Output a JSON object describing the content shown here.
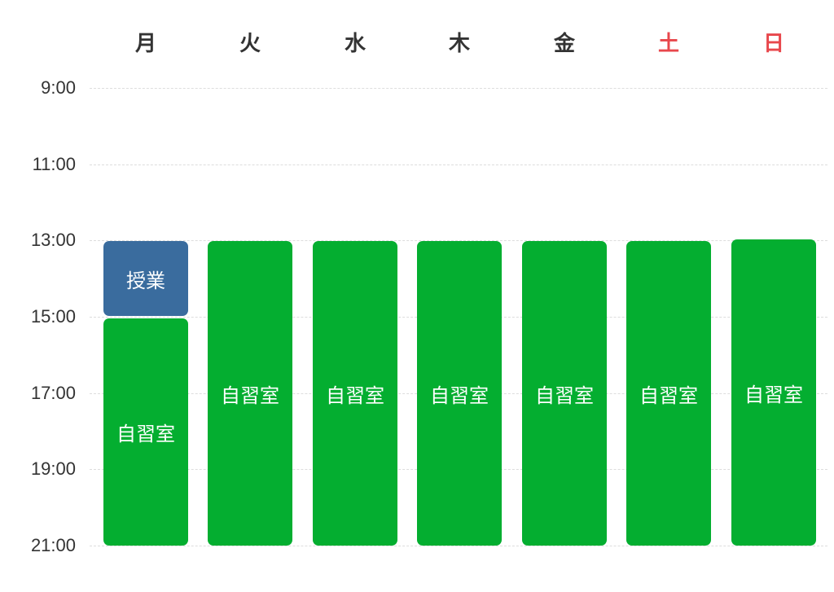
{
  "days": [
    {
      "label": "月",
      "weekend": false
    },
    {
      "label": "火",
      "weekend": false
    },
    {
      "label": "水",
      "weekend": false
    },
    {
      "label": "木",
      "weekend": false
    },
    {
      "label": "金",
      "weekend": false
    },
    {
      "label": "土",
      "weekend": true
    },
    {
      "label": "日",
      "weekend": true
    }
  ],
  "times": [
    "9:00",
    "11:00",
    "13:00",
    "15:00",
    "17:00",
    "19:00",
    "21:00"
  ],
  "colors": {
    "study": "#04ae30",
    "class": "#3a6c9e",
    "weekend_text": "#e8474c",
    "text": "#333333"
  },
  "events": [
    {
      "day": "月",
      "label": "授業",
      "kind": "class",
      "start": "13:00",
      "end": "15:00"
    },
    {
      "day": "月",
      "label": "自習室",
      "kind": "study",
      "start": "15:00",
      "end": "21:00"
    },
    {
      "day": "火",
      "label": "自習室",
      "kind": "study",
      "start": "13:00",
      "end": "21:00"
    },
    {
      "day": "水",
      "label": "自習室",
      "kind": "study",
      "start": "13:00",
      "end": "21:00"
    },
    {
      "day": "木",
      "label": "自習室",
      "kind": "study",
      "start": "13:00",
      "end": "21:00"
    },
    {
      "day": "金",
      "label": "自習室",
      "kind": "study",
      "start": "13:00",
      "end": "21:00"
    },
    {
      "day": "土",
      "label": "自習室",
      "kind": "study",
      "start": "13:00",
      "end": "21:00"
    },
    {
      "day": "日",
      "label": "自習室",
      "kind": "study",
      "start": "13:00",
      "end": "21:00"
    }
  ]
}
